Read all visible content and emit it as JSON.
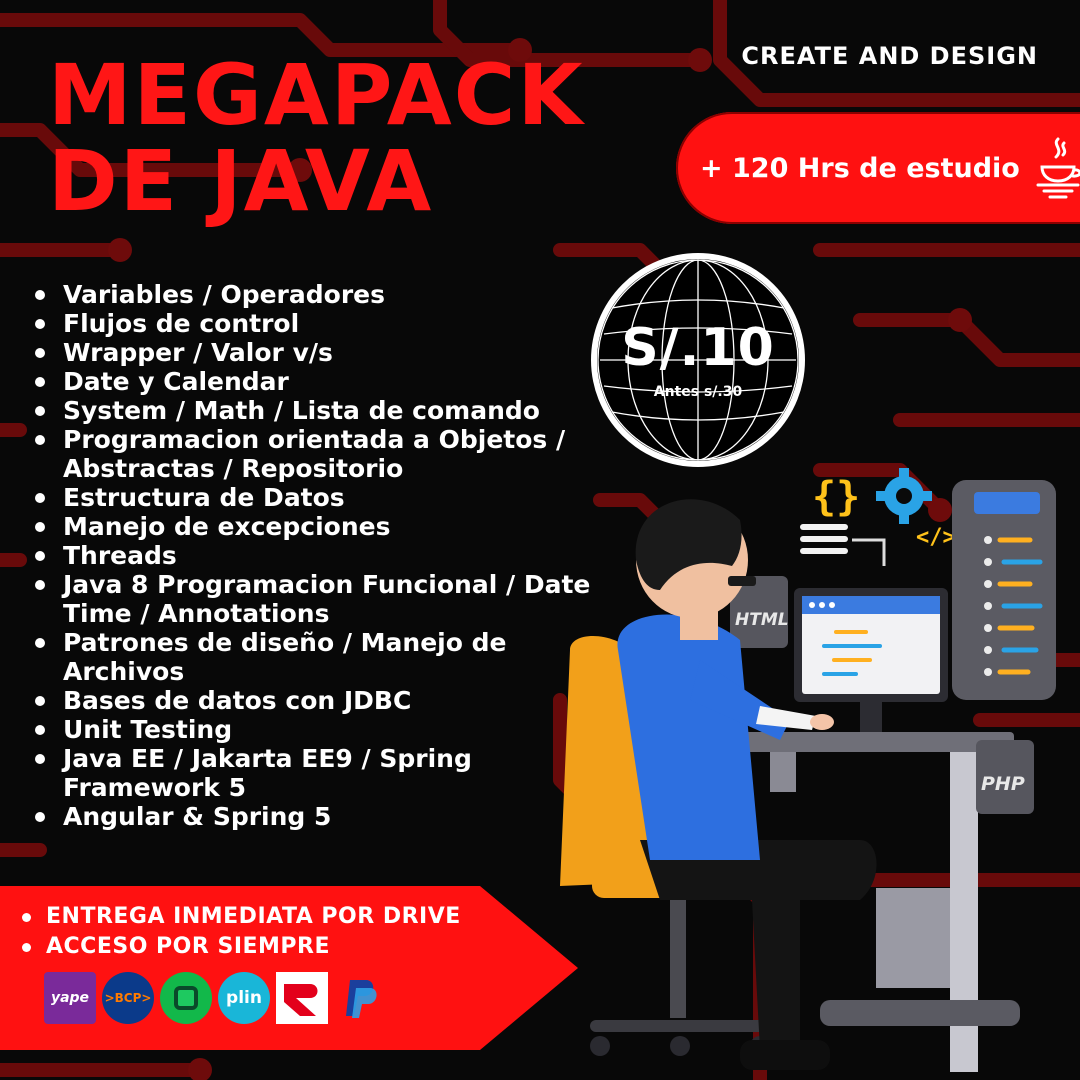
{
  "brand": "CREATE AND DESIGN",
  "headline": {
    "line1": "MEGAPACK",
    "line2": "DE JAVA"
  },
  "hours_badge": {
    "text": "+ 120 Hrs de estudio",
    "icon": "java-cup-icon"
  },
  "price": {
    "current": "S/.10",
    "before": "Antes s/.30",
    "icon": "globe-icon"
  },
  "topics": [
    "Variables / Operadores",
    "Flujos de control",
    "Wrapper / Valor v/s",
    "Date y Calendar",
    "System / Math / Lista de comando",
    "Programacion orientada a Objetos / Abstractas / Repositorio",
    "Estructura de Datos",
    "Manejo de excepciones",
    "Threads",
    "Java 8 Programacion Funcional / Date Time / Annotations",
    "Patrones de diseño / Manejo de Archivos",
    "Bases de datos con JDBC",
    "Unit Testing",
    "Java EE / Jakarta EE9 / Spring Framework 5",
    "Angular & Spring 5"
  ],
  "perks": [
    "ENTREGA INMEDIATA POR DRIVE",
    "ACCESO POR SIEMPRE"
  ],
  "payments": [
    {
      "name": "yape",
      "label": "yape"
    },
    {
      "name": "bcp",
      "label": ">BCP>"
    },
    {
      "name": "interbank",
      "label": ""
    },
    {
      "name": "plin",
      "label": "plin"
    },
    {
      "name": "bbva",
      "label": ""
    },
    {
      "name": "paypal",
      "label": ""
    }
  ],
  "illustration": {
    "screen_tags": [
      "HTML",
      "PHP"
    ],
    "icons": [
      "curly-braces-icon",
      "gear-icon",
      "code-tag-icon"
    ]
  },
  "colors": {
    "accent_red": "#ff1616",
    "background": "#080808",
    "circuit_red": "#7a0a0a",
    "text_white": "#ffffff"
  }
}
